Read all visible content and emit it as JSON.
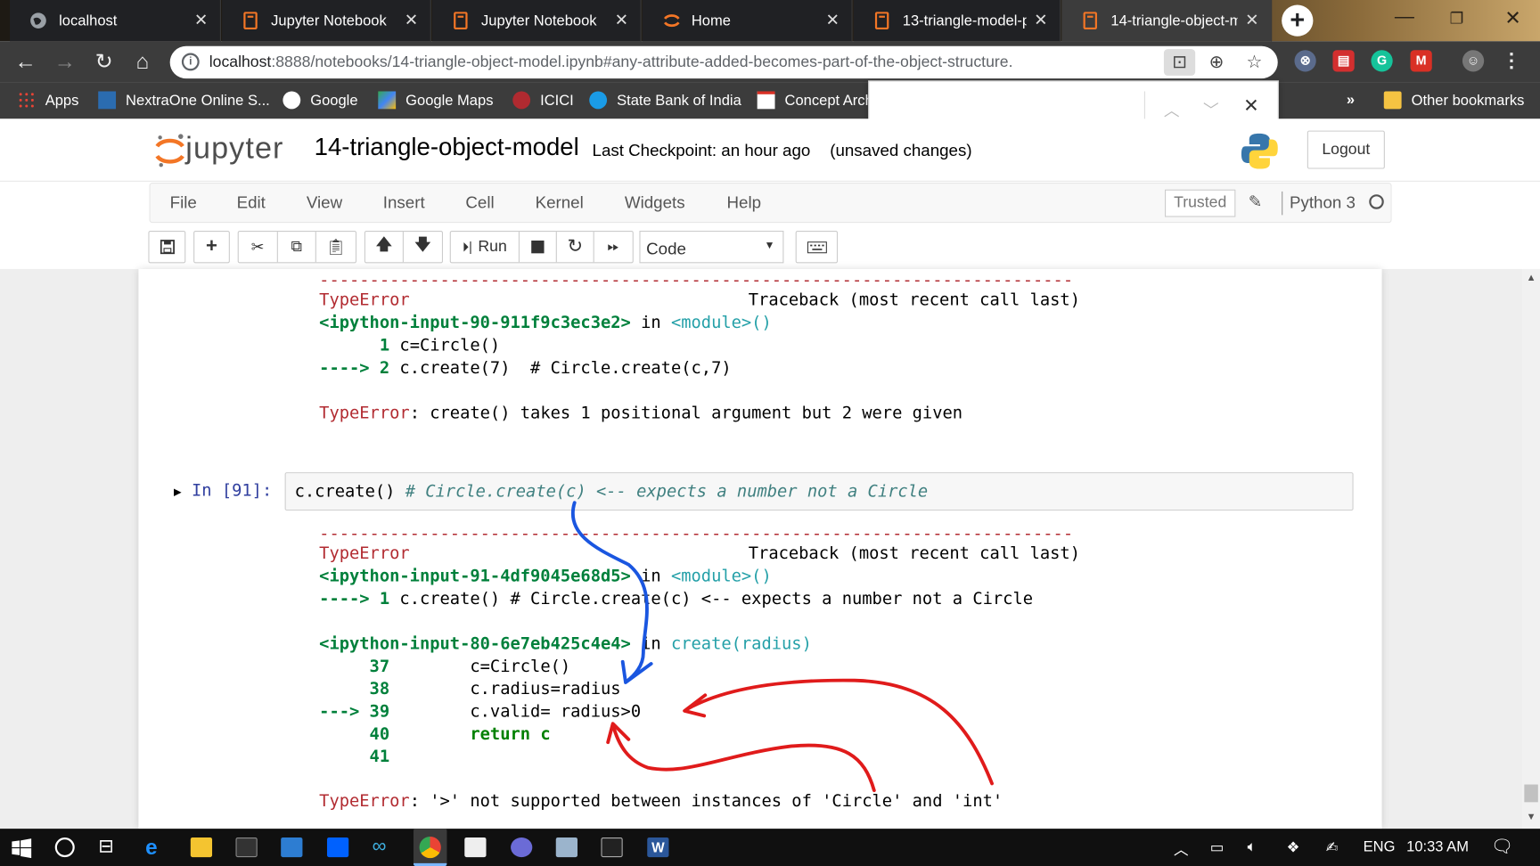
{
  "browser": {
    "tabs": [
      {
        "title": "localhost",
        "icon": "globe-icon",
        "active": false
      },
      {
        "title": "Jupyter Notebook",
        "icon": "notebook-icon",
        "active": false
      },
      {
        "title": "Jupyter Notebook",
        "icon": "notebook-icon",
        "active": false
      },
      {
        "title": "Home",
        "icon": "jupyter-icon",
        "active": false
      },
      {
        "title": "13-triangle-model-p",
        "icon": "notebook-icon",
        "active": false
      },
      {
        "title": "14-triangle-object-m",
        "icon": "notebook-icon",
        "active": true
      }
    ],
    "url_host": "localhost",
    "url_path": ":8888/notebooks/14-triangle-object-model.ipynb#any-attribute-added-becomes-part-of-the-object-structure.",
    "bookmarks": [
      {
        "label": "Apps",
        "icon": "apps-grid-icon"
      },
      {
        "label": "NextraOne Online S...",
        "icon": "nextraone-icon"
      },
      {
        "label": "Google",
        "icon": "google-icon"
      },
      {
        "label": "Google Maps",
        "icon": "maps-icon"
      },
      {
        "label": "ICICI",
        "icon": "icici-icon"
      },
      {
        "label": "State Bank of India",
        "icon": "sbi-icon"
      },
      {
        "label": "Concept Arch",
        "icon": "gmail-icon"
      }
    ],
    "bookmarks_overflow": "»",
    "other_bookmarks": "Other bookmarks"
  },
  "jupyter": {
    "logo_text": "jupyter",
    "notebook_name": "14-triangle-object-model",
    "checkpoint": "Last Checkpoint: an hour ago",
    "status": "(unsaved changes)",
    "logout": "Logout",
    "menu": [
      "File",
      "Edit",
      "View",
      "Insert",
      "Cell",
      "Kernel",
      "Widgets",
      "Help"
    ],
    "trusted": "Trusted",
    "kernel": "Python 3",
    "run_label": "Run",
    "cell_type": "Code"
  },
  "output1": {
    "dashes": "---------------------------------------------------------------------------",
    "error": "TypeError",
    "traceback": "Traceback (most recent call last)",
    "input_ref": "<ipython-input-90-911f9c3ec3e2>",
    "in_word": " in ",
    "module": "<module>()",
    "line1_num": "      1",
    "line1_code": " c=Circle()",
    "line2_arrow": "----> 2",
    "line2_code": " c.create(7)  # Circle.create(c,7)",
    "message_label": "TypeError",
    "message": ": create() takes 1 positional argument but 2 were given"
  },
  "cell": {
    "prompt": "In [91]:",
    "code": "c.create()",
    "comment": " # Circle.create(c) <-- expects a number not a Circle"
  },
  "output2": {
    "dashes": "---------------------------------------------------------------------------",
    "error": "TypeError",
    "traceback": "Traceback (most recent call last)",
    "input_ref": "<ipython-input-91-4df9045e68d5>",
    "in_word": " in ",
    "module": "<module>()",
    "arrow1": "----> 1",
    "arrow1_code": " c.create() # Circle.create(c) <-- expects a number not a Circle",
    "input_ref2": "<ipython-input-80-6e7eb425c4e4>",
    "func": "create(radius)",
    "lines": [
      {
        "num": "     37",
        "code": "        c=Circle()"
      },
      {
        "num": "     38",
        "code": "        c.radius=radius"
      },
      {
        "num": "---> 39",
        "code": "        c.valid= radius>0"
      },
      {
        "num": "     40",
        "code": "        return c"
      },
      {
        "num": "     41",
        "code": ""
      }
    ],
    "message_label": "TypeError",
    "message": ": '>' not supported between instances of 'Circle' and 'int'"
  },
  "taskbar": {
    "language": "ENG",
    "time": "10:33 AM"
  },
  "colors": {
    "error_red": "#b22b31",
    "green": "#00803b",
    "annotation_blue": "#1a56e0",
    "annotation_red": "#e01b1b"
  }
}
